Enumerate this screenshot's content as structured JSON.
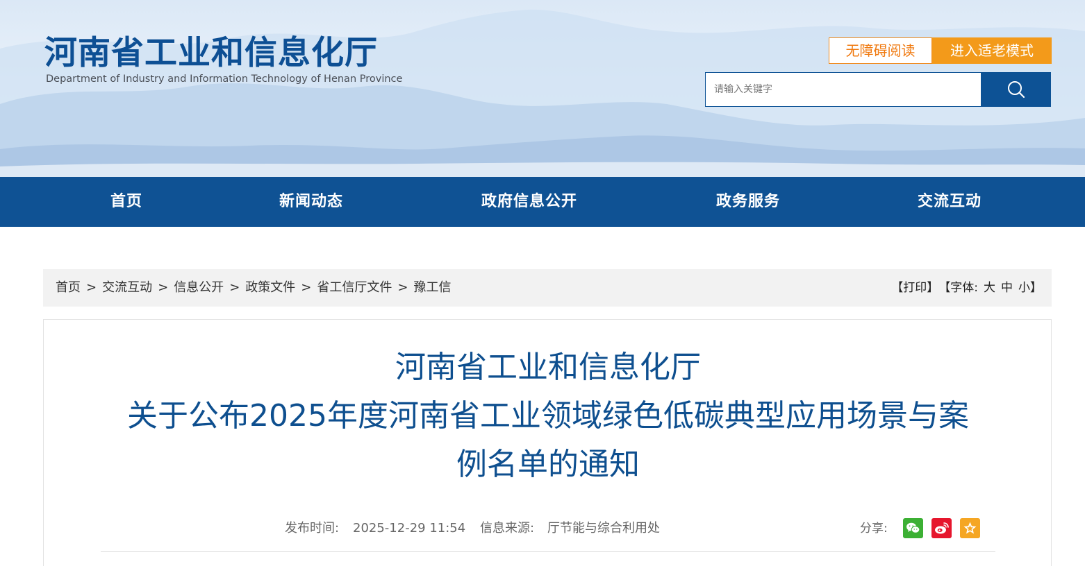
{
  "header": {
    "logo_cn": "河南省工业和信息化厅",
    "logo_en": "Department of Industry and Information Technology of Henan Province",
    "accessibility_label": "无障碍阅读",
    "elder_mode_label": "进入适老模式",
    "search_placeholder": "请输入关键字",
    "search_icon": "search-icon"
  },
  "nav": {
    "items": [
      {
        "label": "首页"
      },
      {
        "label": "新闻动态"
      },
      {
        "label": "政府信息公开"
      },
      {
        "label": "政务服务"
      },
      {
        "label": "交流互动"
      }
    ]
  },
  "breadcrumb": {
    "items": [
      "首页",
      "交流互动",
      "信息公开",
      "政策文件",
      "省工信厅文件",
      "豫工信"
    ],
    "separator": ">"
  },
  "tools": {
    "print": "【打印】",
    "font_label": "【字体:",
    "large": "大",
    "medium": "中",
    "small": "小",
    "close": "】"
  },
  "article": {
    "title_lines": [
      "河南省工业和信息化厅",
      "关于公布2025年度河南省工业领域绿色低碳典型应用场景与案",
      "例名单的通知"
    ],
    "publish_label": "发布时间:",
    "publish_time": "2025-12-29 11:54",
    "source_label": "信息来源:",
    "source": "厅节能与综合利用处",
    "share_label": "分享:",
    "share_icons": [
      "wechat-icon",
      "weibo-icon",
      "favorite-star-icon"
    ]
  },
  "colors": {
    "brand_blue": "#0f5294",
    "title_blue": "#0e4f8f",
    "accent_orange": "#f39a1a",
    "wechat_green": "#3cb034",
    "weibo_red": "#e6162d",
    "favorite_yellow": "#f5a623"
  }
}
